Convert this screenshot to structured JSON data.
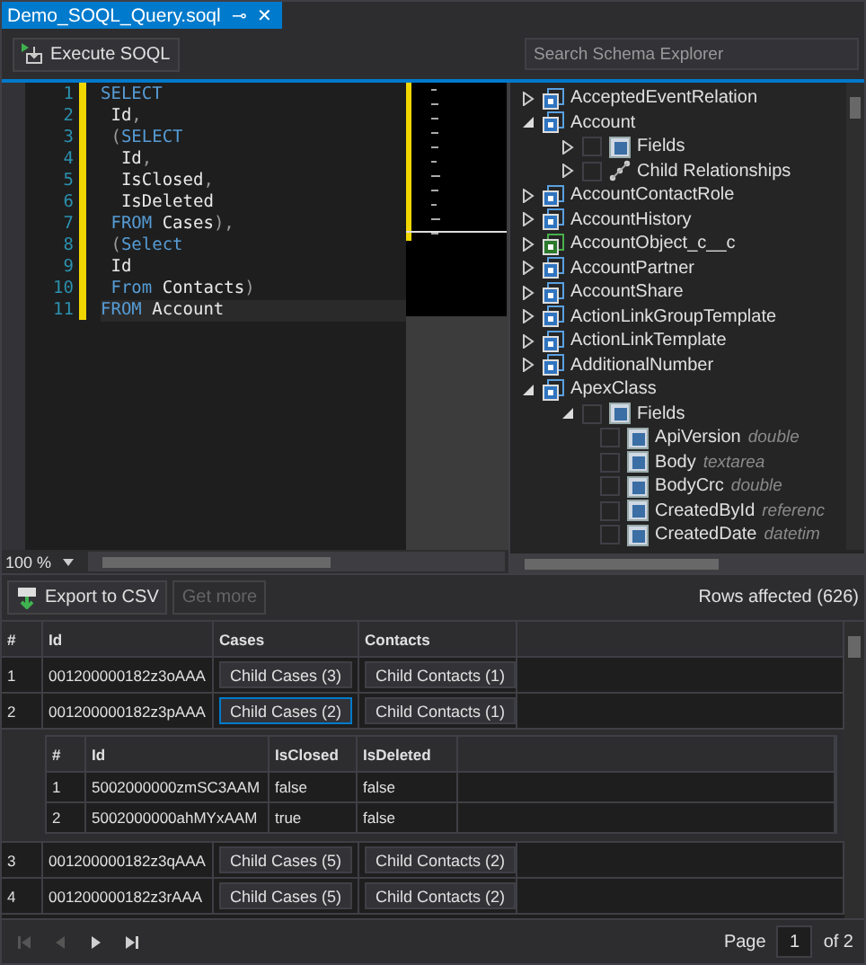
{
  "tab": {
    "title": "Demo_SOQL_Query.soql",
    "pin": "⊸",
    "close": "✕"
  },
  "toolbar": {
    "execute_label": "Execute SOQL"
  },
  "editor": {
    "lines": [
      {
        "number": "1",
        "current": false,
        "tokens": [
          {
            "kind": "keyword",
            "text": "SELECT"
          }
        ]
      },
      {
        "number": "2",
        "current": false,
        "tokens": [
          {
            "kind": "ident",
            "text": " Id"
          },
          {
            "kind": "punct",
            "text": ","
          }
        ]
      },
      {
        "number": "3",
        "current": false,
        "tokens": [
          {
            "kind": "punct",
            "text": " ("
          },
          {
            "kind": "keyword",
            "text": "SELECT"
          }
        ]
      },
      {
        "number": "4",
        "current": false,
        "tokens": [
          {
            "kind": "ident",
            "text": "  Id"
          },
          {
            "kind": "punct",
            "text": ","
          }
        ]
      },
      {
        "number": "5",
        "current": false,
        "tokens": [
          {
            "kind": "ident",
            "text": "  IsClosed"
          },
          {
            "kind": "punct",
            "text": ","
          }
        ]
      },
      {
        "number": "6",
        "current": false,
        "tokens": [
          {
            "kind": "ident",
            "text": "  IsDeleted"
          }
        ]
      },
      {
        "number": "7",
        "current": false,
        "tokens": [
          {
            "kind": "keyword",
            "text": " FROM"
          },
          {
            "kind": "ident",
            "text": " Cases"
          },
          {
            "kind": "punct",
            "text": "),"
          }
        ]
      },
      {
        "number": "8",
        "current": false,
        "tokens": [
          {
            "kind": "punct",
            "text": " ("
          },
          {
            "kind": "keyword",
            "text": "Select"
          }
        ]
      },
      {
        "number": "9",
        "current": false,
        "tokens": [
          {
            "kind": "ident",
            "text": " Id"
          }
        ]
      },
      {
        "number": "10",
        "current": false,
        "tokens": [
          {
            "kind": "keyword",
            "text": " From"
          },
          {
            "kind": "ident",
            "text": " Contacts"
          },
          {
            "kind": "punct",
            "text": ")"
          }
        ]
      },
      {
        "number": "11",
        "current": true,
        "tokens": [
          {
            "kind": "keyword",
            "text": "FROM"
          },
          {
            "kind": "ident",
            "text": " Account"
          }
        ]
      }
    ],
    "zoom": "100 %"
  },
  "schema_explorer": {
    "placeholder": "Search Schema Explorer",
    "items": [
      {
        "kind": "object",
        "label": "AcceptedEventRelation",
        "expanded": false
      },
      {
        "kind": "object",
        "label": "Account",
        "expanded": true,
        "children": [
          {
            "kind": "fields",
            "label": "Fields",
            "expanded": false,
            "checked": false
          },
          {
            "kind": "relationships",
            "label": "Child Relationships",
            "expanded": false,
            "checked": false
          }
        ]
      },
      {
        "kind": "object",
        "label": "AccountContactRole",
        "expanded": false
      },
      {
        "kind": "object",
        "label": "AccountHistory",
        "expanded": false
      },
      {
        "kind": "custom_object",
        "label": "AccountObject_c__c",
        "expanded": false
      },
      {
        "kind": "object",
        "label": "AccountPartner",
        "expanded": false
      },
      {
        "kind": "object",
        "label": "AccountShare",
        "expanded": false
      },
      {
        "kind": "object",
        "label": "ActionLinkGroupTemplate",
        "expanded": false
      },
      {
        "kind": "object",
        "label": "ActionLinkTemplate",
        "expanded": false
      },
      {
        "kind": "object",
        "label": "AdditionalNumber",
        "expanded": false
      },
      {
        "kind": "object",
        "label": "ApexClass",
        "expanded": true,
        "children": [
          {
            "kind": "fields",
            "label": "Fields",
            "expanded": true,
            "checked": false,
            "children": [
              {
                "kind": "field",
                "label": "ApiVersion",
                "type": "double",
                "checked": false
              },
              {
                "kind": "field",
                "label": "Body",
                "type": "textarea",
                "checked": false
              },
              {
                "kind": "field",
                "label": "BodyCrc",
                "type": "double",
                "checked": false
              },
              {
                "kind": "field",
                "label": "CreatedById",
                "type": "referenc",
                "checked": false
              },
              {
                "kind": "field",
                "label": "CreatedDate",
                "type": "datetim",
                "checked": false
              }
            ]
          }
        ]
      }
    ]
  },
  "results": {
    "export_label": "Export to CSV",
    "get_more_label": "Get more",
    "get_more_disabled": true,
    "rows_affected": "Rows affected (626)",
    "columns": [
      "#",
      "Id",
      "Cases",
      "Contacts"
    ],
    "rows": [
      {
        "num": "1",
        "id": "001200000182z3oAAA",
        "cases": {
          "label": "Child Cases (3)",
          "selected": false
        },
        "contacts": {
          "label": "Child Contacts (1)",
          "selected": false
        }
      },
      {
        "num": "2",
        "id": "001200000182z3pAAA",
        "cases": {
          "label": "Child Cases (2)",
          "selected": true
        },
        "contacts": {
          "label": "Child Contacts (1)",
          "selected": false
        },
        "child_table": {
          "columns": [
            "#",
            "Id",
            "IsClosed",
            "IsDeleted"
          ],
          "rows": [
            [
              "1",
              "5002000000zmSC3AAM",
              "false",
              "false"
            ],
            [
              "2",
              "5002000000ahMYxAAM",
              "true",
              "false"
            ]
          ]
        }
      },
      {
        "num": "3",
        "id": "001200000182z3qAAA",
        "cases": {
          "label": "Child Cases (5)",
          "selected": false
        },
        "contacts": {
          "label": "Child Contacts (2)",
          "selected": false
        }
      },
      {
        "num": "4",
        "id": "001200000182z3rAAA",
        "cases": {
          "label": "Child Cases (5)",
          "selected": false
        },
        "contacts": {
          "label": "Child Contacts (2)",
          "selected": false
        }
      }
    ]
  },
  "pager": {
    "first_disabled": true,
    "prev_disabled": true,
    "next_disabled": false,
    "last_disabled": false,
    "page_label": "Page",
    "page": "1",
    "of_label": "of 2"
  }
}
